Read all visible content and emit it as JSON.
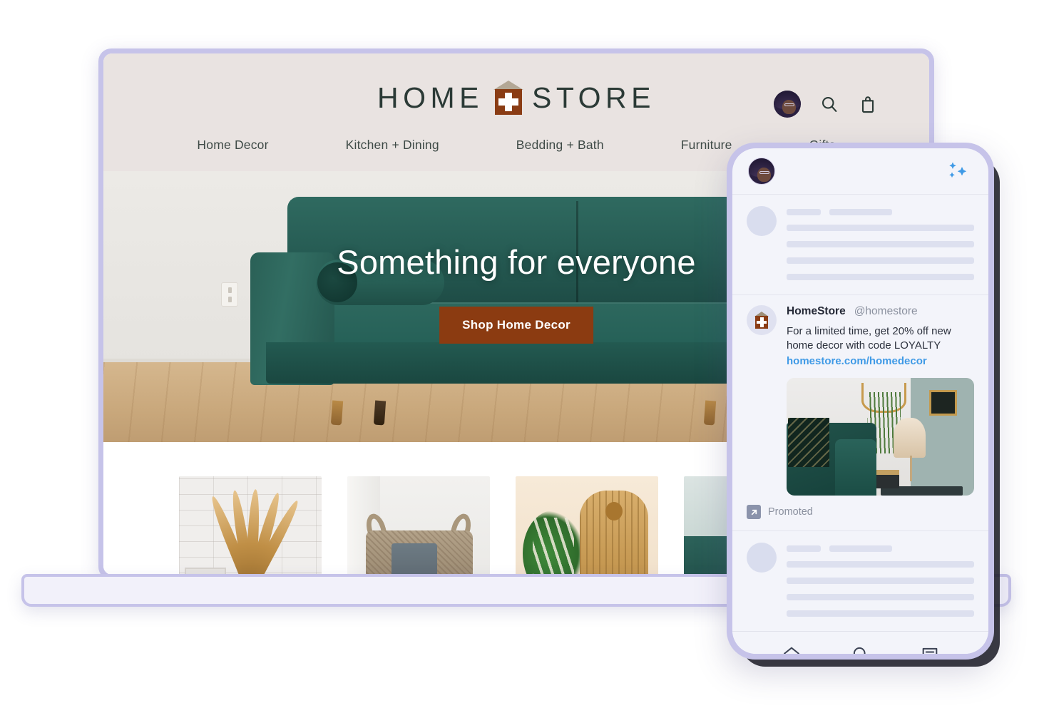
{
  "laptop": {
    "site": {
      "logo": {
        "word_left": "HOME",
        "word_right": "STORE",
        "icon": "house-plus-icon",
        "house_color": "#8a3c14",
        "roof_color": "#b3a795"
      },
      "header_actions": [
        {
          "name": "account-avatar",
          "icon": "avatar"
        },
        {
          "name": "search-icon",
          "icon": "magnifier"
        },
        {
          "name": "cart-icon",
          "icon": "shopping-bag"
        }
      ],
      "nav": [
        {
          "label": "Home Decor"
        },
        {
          "label": "Kitchen + Dining"
        },
        {
          "label": "Bedding + Bath"
        },
        {
          "label": "Furniture"
        },
        {
          "label": "Gifts"
        }
      ],
      "hero": {
        "headline": "Something for everyone",
        "cta_label": "Shop Home Decor",
        "cta_color": "#8b3b11",
        "image_alt": "green-velvet-sofa-in-living-room"
      },
      "products": [
        {
          "name": "product-card-pampas-grass"
        },
        {
          "name": "product-card-woven-basket"
        },
        {
          "name": "product-card-rattan-chair"
        },
        {
          "name": "product-card-partial"
        }
      ]
    }
  },
  "phone": {
    "topbar": {
      "avatar": "user-avatar",
      "sparkle_icon": "sparkles-icon",
      "sparkle_color": "#3f9ae6"
    },
    "feed": {
      "skeleton_top": {
        "head_bars": 2,
        "body_bars": 4
      },
      "promoted_post": {
        "display_name": "HomeStore",
        "handle": "@homestore",
        "text": "For a limited time, get 20% off new home decor with code LOYALTY",
        "link": "homestore.com/homedecor",
        "link_color": "#3f9ae6",
        "image_alt": "styled-living-room-with-green-sofa-plant-and-lamp",
        "promoted_label": "Promoted",
        "promoted_icon": "diagonal-arrow-icon"
      },
      "skeleton_bottom": {
        "head_bars": 2,
        "body_bars": 4
      }
    },
    "bottom_nav": [
      {
        "name": "nav-home",
        "icon": "home-icon"
      },
      {
        "name": "nav-search",
        "icon": "search-icon"
      },
      {
        "name": "nav-messages",
        "icon": "message-icon"
      }
    ]
  },
  "theme": {
    "frame_color": "#c6c3e9",
    "brand_brown": "#8a3c14",
    "accent_blue": "#3f9ae6",
    "sofa_green": "#225a51"
  }
}
